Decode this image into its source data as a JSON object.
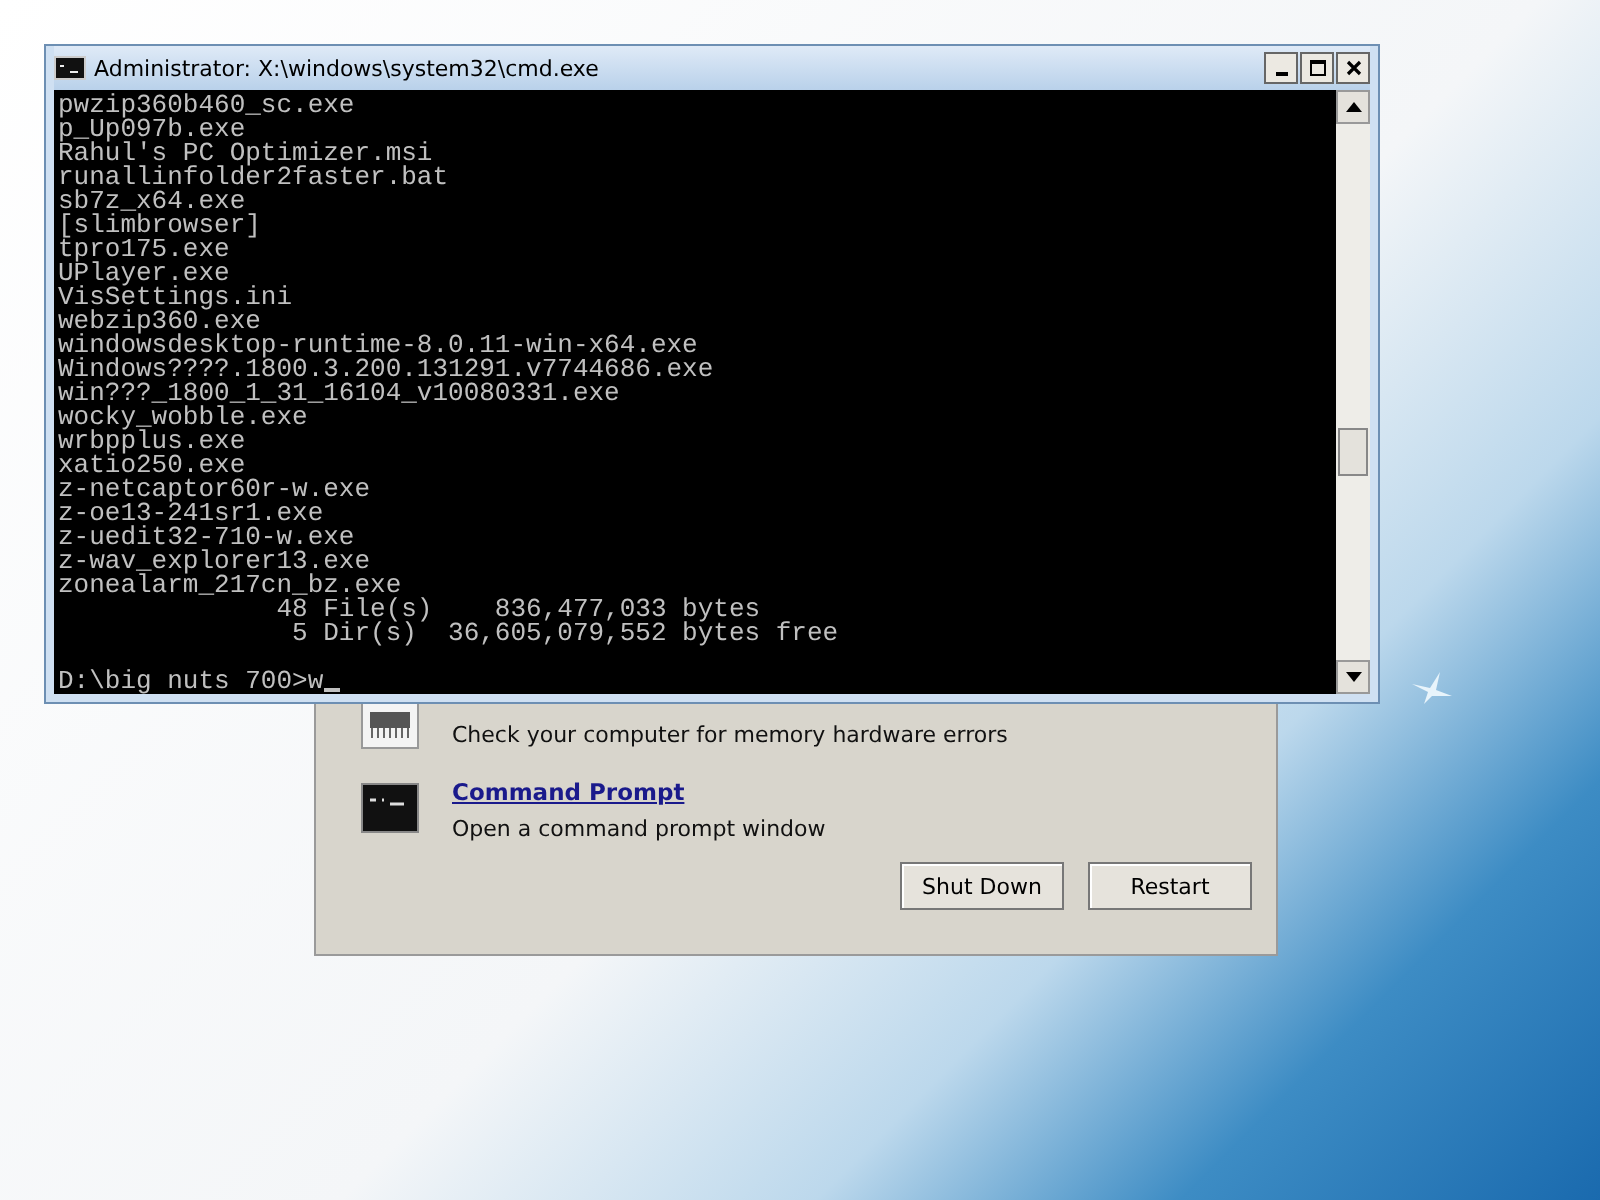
{
  "recovery_dialog": {
    "tools": [
      {
        "kind": "memory",
        "description": "Check your computer for memory hardware errors"
      },
      {
        "kind": "prompt",
        "title": "Command Prompt",
        "description": "Open a command prompt window"
      }
    ],
    "buttons": [
      "Shut Down",
      "Restart"
    ]
  },
  "console_window": {
    "title": "Administrator: X:\\windows\\system32\\cmd.exe",
    "lines": [
      "pwzip360b460_sc.exe",
      "p_Up097b.exe",
      "Rahul's PC Optimizer.msi",
      "runallinfolder2faster.bat",
      "sb7z_x64.exe",
      "[slimbrowser]",
      "tpro175.exe",
      "UPlayer.exe",
      "VisSettings.ini",
      "webzip360.exe",
      "windowsdesktop-runtime-8.0.11-win-x64.exe",
      "Windows????.1800.3.200.131291.v7744686.exe",
      "win???_1800_1_31_16104_v10080331.exe",
      "wocky_wobble.exe",
      "wrbpplus.exe",
      "xatio250.exe",
      "z-netcaptor60r-w.exe",
      "z-oe13-241sr1.exe",
      "z-uedit32-710-w.exe",
      "z-wav_explorer13.exe",
      "zonealarm_217cn_bz.exe",
      "              48 File(s)    836,477,033 bytes",
      "               5 Dir(s)  36,605,079,552 bytes free"
    ],
    "prompt": "D:\\big nuts 700>",
    "input": "w"
  }
}
